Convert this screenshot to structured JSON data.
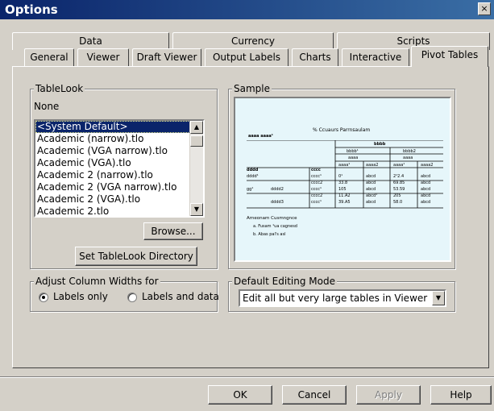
{
  "window": {
    "title": "Options",
    "close_glyph": "×"
  },
  "tabs_back": [
    "Data",
    "Currency",
    "Scripts"
  ],
  "tabs_front": [
    "General",
    "Viewer",
    "Draft Viewer",
    "Output Labels",
    "Charts",
    "Interactive",
    "Pivot Tables"
  ],
  "active_tab": "Pivot Tables",
  "tablelook": {
    "group_label": "TableLook",
    "current": "None",
    "items": [
      "<System Default>",
      "Academic (narrow).tlo",
      "Academic (VGA narrow).tlo",
      "Academic (VGA).tlo",
      "Academic 2 (narrow).tlo",
      "Academic 2 (VGA narrow).tlo",
      "Academic 2 (VGA).tlo",
      "Academic 2.tlo"
    ],
    "selected_index": 0,
    "browse_label": "Browse...",
    "set_dir_label": "Set TableLook Directory"
  },
  "sample": {
    "group_label": "Sample",
    "table_title": "% Ccuaurs Parrnsaulam",
    "caption": "aaaa aaaa¹",
    "col_top": "bbbb",
    "col_groups": [
      "bbbb¹",
      "bbbb2"
    ],
    "col_sub": [
      "aaaa",
      "aaaa"
    ],
    "col_heads": [
      "aaaa¹",
      "aaaa2",
      "aaaa¹",
      "aaaa2"
    ],
    "rows": [
      [
        "dddd",
        "",
        "cccc",
        "",
        "",
        "",
        ""
      ],
      [
        "dddd¹",
        "",
        "cccc¹",
        "0¹",
        "abcd",
        "2¹2.4",
        "abcd"
      ],
      [
        "",
        "",
        "cccc2",
        "33.8",
        "abcd",
        "69.85",
        "abcd"
      ],
      [
        "gg¹",
        "dddd2",
        "cccc¹",
        "105",
        "abcd",
        "53.59",
        "abcd"
      ],
      [
        "",
        "",
        "cccc2",
        "11.A2",
        "abcd¹",
        "205",
        "abcd"
      ],
      [
        "",
        "dddd3",
        "cccc¹",
        "39.A5",
        "abcd",
        "58.0",
        "abcd"
      ]
    ],
    "notes": [
      "Arneonam Cusmngnce",
      "a. Fusam ¹ua cagnesd",
      "b. Abas pal's asl"
    ]
  },
  "adjust": {
    "group_label": "Adjust Column Widths for",
    "options": [
      "Labels only",
      "Labels and data"
    ],
    "selected_index": 0
  },
  "editing": {
    "group_label": "Default Editing Mode",
    "value": "Edit all but very large tables in Viewer"
  },
  "footer": {
    "ok": "OK",
    "cancel": "Cancel",
    "apply": "Apply",
    "help": "Help"
  },
  "icons": {
    "scroll_up": "scroll-up-arrow-icon",
    "scroll_down": "scroll-down-arrow-icon",
    "combo": "chevron-down-icon"
  }
}
